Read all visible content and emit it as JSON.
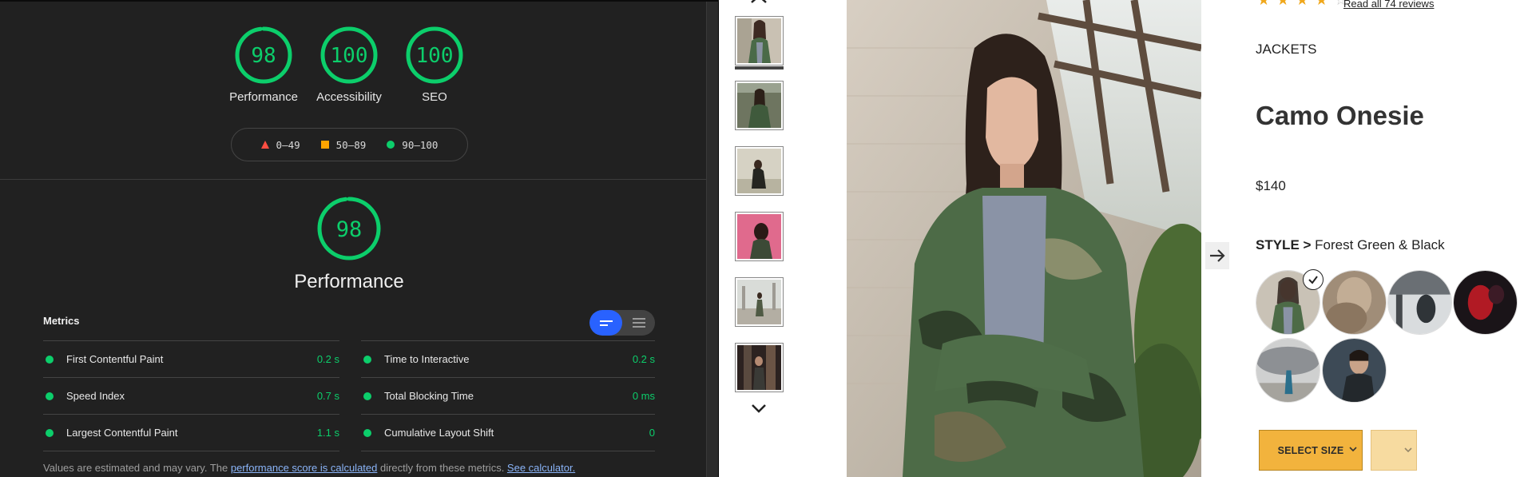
{
  "lighthouse": {
    "scores": [
      {
        "label": "Performance",
        "value": "98",
        "percent": 98
      },
      {
        "label": "Accessibility",
        "value": "100",
        "percent": 100
      },
      {
        "label": "SEO",
        "value": "100",
        "percent": 100
      }
    ],
    "legend": {
      "fail": "0–49",
      "average": "50–89",
      "pass": "90–100"
    },
    "performance": {
      "value": "98",
      "percent": 98,
      "title": "Performance"
    },
    "metrics_title": "Metrics",
    "metrics": [
      {
        "name": "First Contentful Paint",
        "value": "0.2 s"
      },
      {
        "name": "Time to Interactive",
        "value": "0.2 s"
      },
      {
        "name": "Speed Index",
        "value": "0.7 s"
      },
      {
        "name": "Total Blocking Time",
        "value": "0 ms"
      },
      {
        "name": "Largest Contentful Paint",
        "value": "1.1 s"
      },
      {
        "name": "Cumulative Layout Shift",
        "value": "0"
      }
    ],
    "note": {
      "prefix": "Values are estimated and may vary. The ",
      "link1": "performance score is calculated",
      "middle": " directly from these metrics. ",
      "link2": "See calculator."
    },
    "colors": {
      "pass": "#0cce6b",
      "average": "#ffa400",
      "fail": "#ff4e42",
      "toggle_active": "#2962ff"
    }
  },
  "product": {
    "rating": {
      "stars": 4,
      "max": 5
    },
    "reviews_link": "Read all 74 reviews",
    "category": "JACKETS",
    "name": "Camo Onesie",
    "price": "$140",
    "style_label": "STYLE >",
    "style_value": "Forest Green & Black",
    "select_size": "SELECT SIZE",
    "icons": [
      "chevron-up-icon",
      "chevron-down-icon",
      "arrow-right-icon",
      "checkmark-icon"
    ],
    "colors": {
      "button": "#f2b33d",
      "star": "#f0a81d"
    }
  }
}
